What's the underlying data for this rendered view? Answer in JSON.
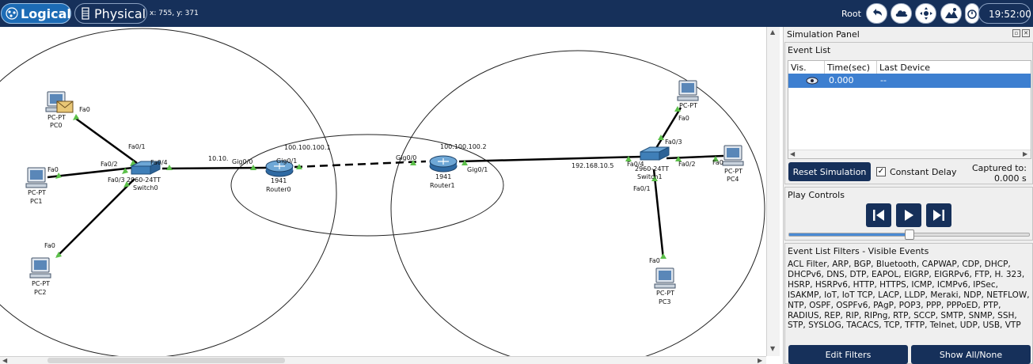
{
  "topbar": {
    "logical_label": "Logical",
    "physical_label": "Physical",
    "coords": "x: 755, y: 371",
    "root_label": "Root",
    "clock": "19:52:00",
    "icons": [
      "back-arrow-icon",
      "cloud-icon",
      "move-icon",
      "landscape-icon",
      "timer-icon"
    ]
  },
  "topology": {
    "devices": {
      "pc0": {
        "type": "PC-PT",
        "name": "PC0"
      },
      "pc1": {
        "type": "PC-PT",
        "name": "PC1"
      },
      "pc2": {
        "type": "PC-PT",
        "name": "PC2"
      },
      "pc3": {
        "type": "PC-PT",
        "name": "PC3"
      },
      "pc4": {
        "type": "PC-PT",
        "name": "PC4"
      },
      "pc_top": {
        "type": "PC-PT",
        "name": ""
      },
      "switch0": {
        "type": "2960-24TT",
        "name": "Switch0"
      },
      "switch1": {
        "type": "2960-24TT",
        "name": "Switch1"
      },
      "router0": {
        "type": "1941",
        "name": "Router0"
      },
      "router1": {
        "type": "1941",
        "name": "Router1"
      }
    },
    "port_labels": {
      "pc0_fa0": "Fa0",
      "sw0_fa01": "Fa0/1",
      "pc1_fa0": "Fa0",
      "sw0_fa02": "Fa0/2",
      "sw0_fa03": "Fa0/3",
      "pc2_fa0": "Fa0",
      "sw0_fa04": "Fa0/4",
      "r0_gig00": "Gig0/0",
      "r0_gig01": "Gig0/1",
      "r1_gig00": "Gig0/0",
      "r1_gig01": "Gig0/1",
      "sw1_fa04": "Fa0/4",
      "sw1_fa03": "Fa0/3",
      "sw1_fa02": "Fa0/2",
      "sw1_fa01": "Fa0/1",
      "pc3_fa0": "Fa0",
      "pc4_fa0": "Fa0",
      "pctop_fa0": "Fa0"
    },
    "ip_labels": {
      "net_left": "10.10.",
      "r0_wan": "100.100.100.1",
      "r1_wan": "100.100.100.2",
      "net_right": "192.168.10.5"
    }
  },
  "panel": {
    "title": "Simulation Panel",
    "event_list": {
      "title": "Event List",
      "columns": [
        "Vis.",
        "Time(sec)",
        "Last Device"
      ],
      "rows": [
        {
          "vis": "eye-icon",
          "time": "0.000",
          "last_device": "--"
        }
      ]
    },
    "reset_label": "Reset Simulation",
    "constant_delay_label": "Constant Delay",
    "constant_delay_checked": true,
    "captured_label": "Captured to:",
    "captured_value": "0.000 s",
    "play_controls": {
      "title": "Play Controls",
      "buttons": [
        "skip-back-icon",
        "play-icon",
        "skip-forward-icon"
      ],
      "speed_fraction": 0.5
    },
    "filters": {
      "title": "Event List Filters - Visible Events",
      "text": "ACL Filter, ARP, BGP, Bluetooth, CAPWAP, CDP, DHCP, DHCPv6, DNS, DTP, EAPOL, EIGRP, EIGRPv6, FTP, H. 323, HSRP, HSRPv6, HTTP, HTTPS, ICMP, ICMPv6, IPSec, ISAKMP, IoT, IoT TCP, LACP, LLDP, Meraki, NDP, NETFLOW, NTP, OSPF, OSPFv6, PAgP, POP3, PPP, PPPoED, PTP, RADIUS, REP, RIP, RIPng, RTP, SCCP, SMTP, SNMP, SSH, STP, SYSLOG, TACACS, TCP, TFTP, Telnet, UDP, USB, VTP",
      "edit_label": "Edit Filters",
      "show_all_label": "Show All/None"
    }
  },
  "colors": {
    "topbar": "#16305a",
    "accent": "#1c6bb5",
    "selected_row": "#3d7fd0",
    "link_up": "#5cc04a"
  }
}
